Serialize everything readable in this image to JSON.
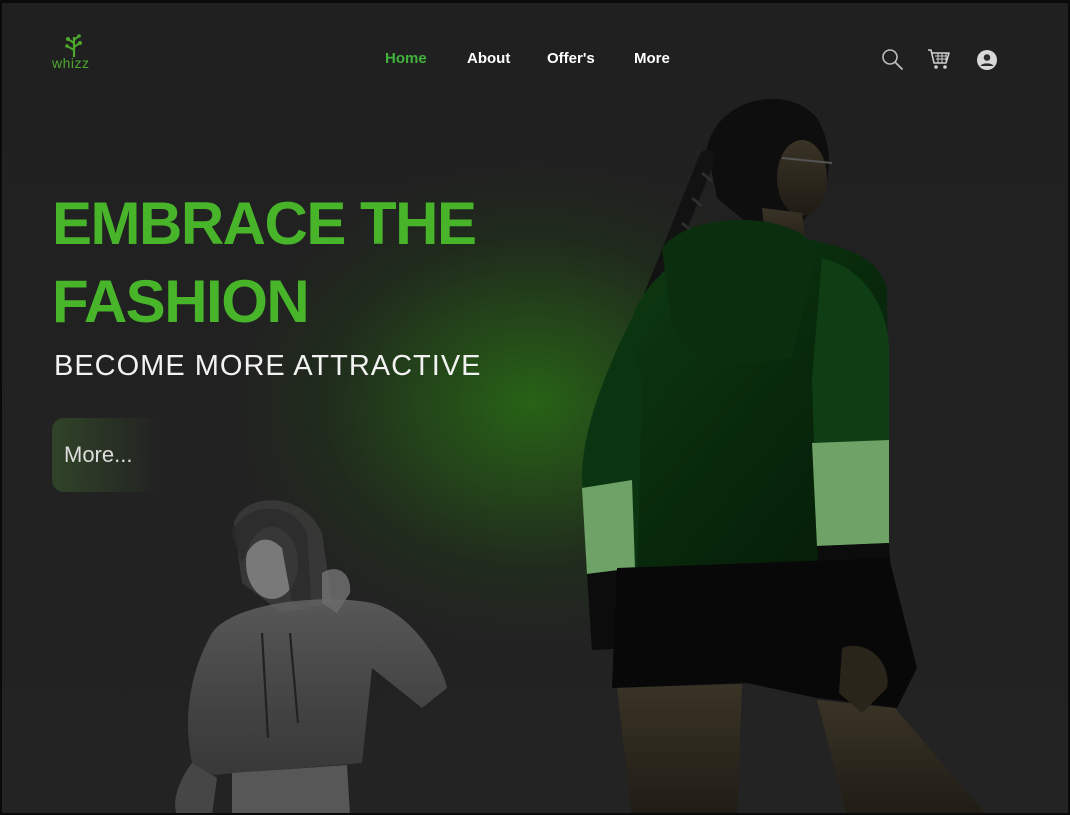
{
  "brand": {
    "logo_text": "whizz"
  },
  "nav": {
    "items": [
      {
        "label": "Home",
        "active": true
      },
      {
        "label": "About",
        "active": false
      },
      {
        "label": "Offer's",
        "active": false
      },
      {
        "label": "More",
        "active": false
      }
    ]
  },
  "header_icons": [
    "search-icon",
    "cart-icon",
    "user-icon"
  ],
  "hero": {
    "title_line1": "EMBRACE THE",
    "title_line2": "FASHION",
    "subtitle": "BECOME MORE ATTRACTIVE",
    "cta_label": "More..."
  },
  "colors": {
    "accent": "#47b42a",
    "nav_active": "#3fb23a",
    "background": "#222222",
    "text": "#ffffff"
  }
}
